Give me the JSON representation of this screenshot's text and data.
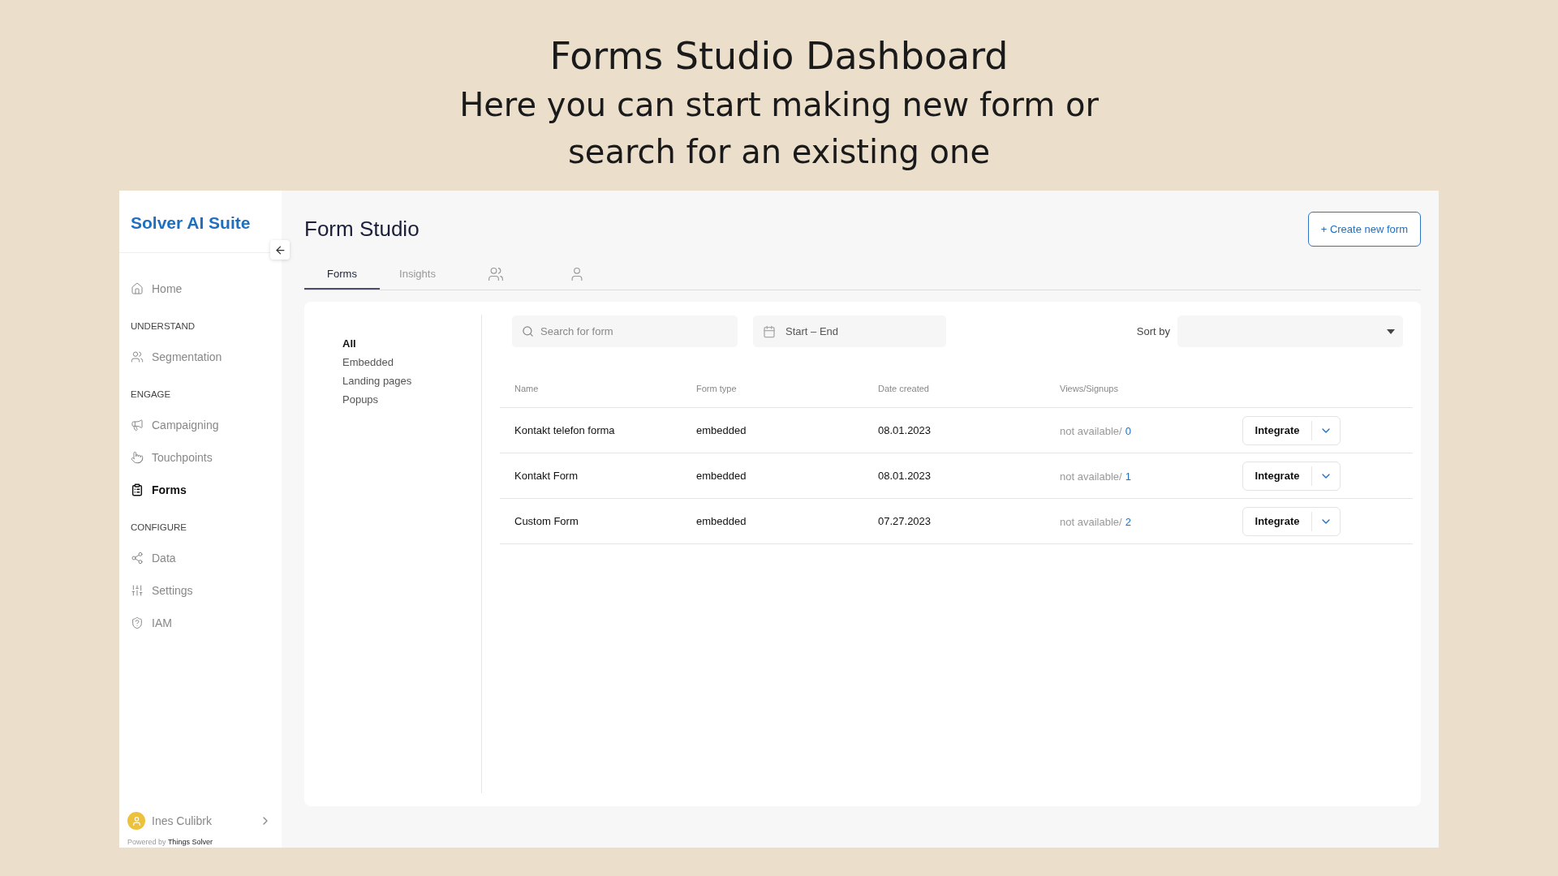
{
  "slide": {
    "title": "Forms Studio Dashboard",
    "subtitle": "Here you can start making new form or search for an existing one"
  },
  "sidebar": {
    "brand": "Solver AI Suite",
    "items": [
      {
        "kind": "item",
        "label": "Home",
        "selected": false
      },
      {
        "kind": "section",
        "label": "UNDERSTAND"
      },
      {
        "kind": "item",
        "label": "Segmentation",
        "selected": false
      },
      {
        "kind": "section",
        "label": "ENGAGE"
      },
      {
        "kind": "item",
        "label": "Campaigning",
        "selected": false
      },
      {
        "kind": "item",
        "label": "Touchpoints",
        "selected": false
      },
      {
        "kind": "item",
        "label": "Forms",
        "selected": true
      },
      {
        "kind": "section",
        "label": "CONFIGURE"
      },
      {
        "kind": "item",
        "label": "Data",
        "selected": false
      },
      {
        "kind": "item",
        "label": "Settings",
        "selected": false
      },
      {
        "kind": "item",
        "label": "IAM",
        "selected": false
      }
    ],
    "user": "Ines Culibrk",
    "footer_prefix": "Powered by",
    "footer_brand": "Things Solver"
  },
  "page": {
    "title": "Form Studio",
    "create_button": "+ Create new form"
  },
  "tabs": [
    {
      "kind": "text",
      "label": "Forms",
      "selected": true
    },
    {
      "kind": "text",
      "label": "Insights",
      "selected": false
    },
    {
      "kind": "icon",
      "selected": false
    },
    {
      "kind": "icon",
      "selected": false
    }
  ],
  "filters": [
    {
      "label": "All",
      "selected": true
    },
    {
      "label": "Embedded",
      "selected": false
    },
    {
      "label": "Landing pages",
      "selected": false
    },
    {
      "label": "Popups",
      "selected": false
    }
  ],
  "search": {
    "placeholder": "Search for form"
  },
  "date_range": {
    "value": "Start – End"
  },
  "sort": {
    "label": "Sort by"
  },
  "table": {
    "columns": [
      "Name",
      "Form type",
      "Date created",
      "Views/Signups"
    ],
    "rows": [
      {
        "name": "Kontakt telefon forma",
        "type": "embedded",
        "date": "08.01.2023",
        "views": "not available/",
        "signups": "0",
        "action": "Integrate"
      },
      {
        "name": "Kontakt Form",
        "type": "embedded",
        "date": "08.01.2023",
        "views": "not available/",
        "signups": "1",
        "action": "Integrate"
      },
      {
        "name": "Custom Form",
        "type": "embedded",
        "date": "07.27.2023",
        "views": "not available/",
        "signups": "2",
        "action": "Integrate"
      }
    ]
  }
}
